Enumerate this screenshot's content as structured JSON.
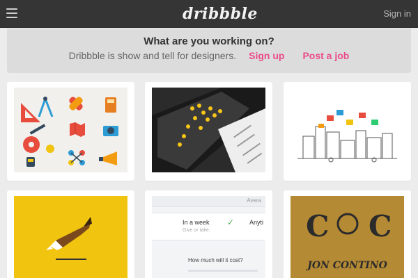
{
  "app": {
    "logo_text": "dribbble",
    "signin_label": "Sign in",
    "menu_icon": "hamburger-icon"
  },
  "promo": {
    "title": "What are you working on?",
    "tagline": "Dribbble is show and tell for designers.",
    "signup_label": "Sign up",
    "post_job_label": "Post a job",
    "accent_color": "#ea4c89"
  },
  "shots": [
    {
      "subject": "flat-icon-set"
    },
    {
      "subject": "map-app-tablet"
    },
    {
      "subject": "city-line-illustration"
    },
    {
      "subject": "gazelle-logo"
    },
    {
      "subject": "pricing-form-ui"
    },
    {
      "subject": "lettering-monogram"
    }
  ],
  "shot_texts": {
    "form_week": "In a week",
    "form_week_sub": "Give or take.",
    "form_any": "Anyti",
    "form_cost": "How much will it cost?",
    "form_avg": "Avera",
    "lettering_name": "JON CONTINO"
  }
}
